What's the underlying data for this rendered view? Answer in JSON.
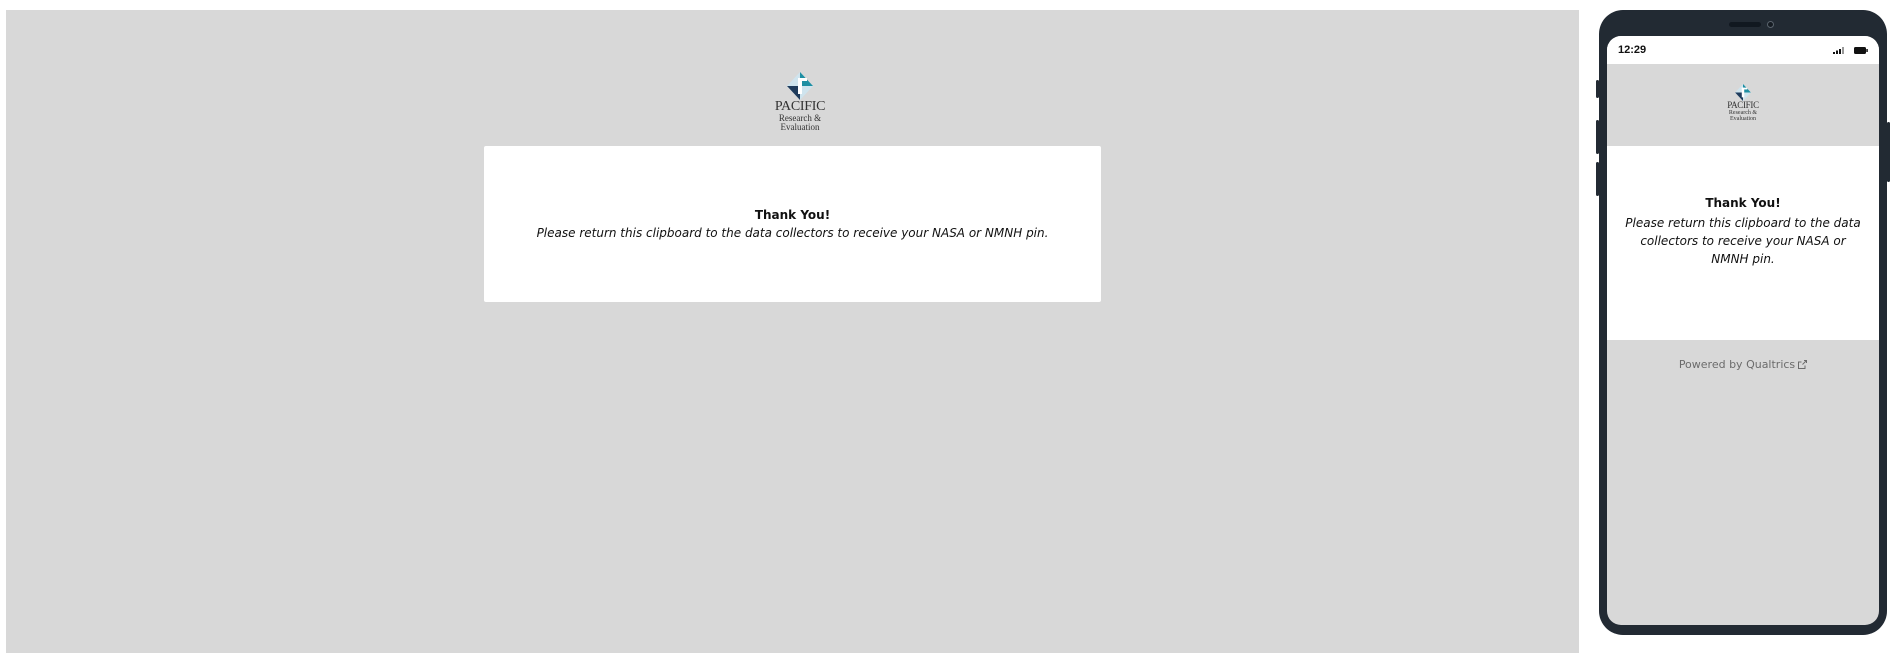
{
  "logo": {
    "line1": "PACIFIC",
    "line2": "Research &",
    "line3": "Evaluation",
    "icon": "pacific-logo-mark",
    "colors": {
      "navy": "#1f3b5c",
      "teal": "#1e8fa3",
      "light": "#cfe4ee"
    }
  },
  "endOfSurvey": {
    "title": "Thank You!",
    "message": "Please return this clipboard to the data collectors to receive your NASA or NMNH pin."
  },
  "phone": {
    "time": "12:29",
    "poweredBy": "Powered by Qualtrics",
    "icons": [
      "signal-icon",
      "battery-icon",
      "external-link-icon"
    ]
  },
  "colors": {
    "background": "#d8d8d8",
    "card": "#ffffff",
    "phoneFrame": "#222a33"
  }
}
